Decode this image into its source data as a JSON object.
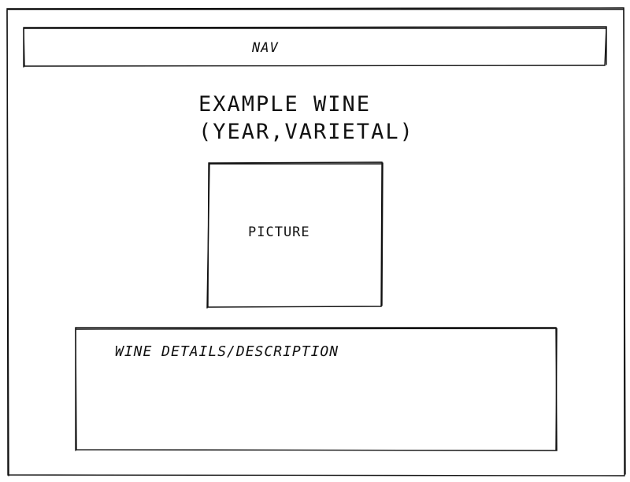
{
  "nav": {
    "label": "NAV"
  },
  "wine": {
    "title_line_1": "EXAMPLE WINE",
    "title_line_2": "(YEAR,VARIETAL)"
  },
  "picture": {
    "label": "PICTURE"
  },
  "details": {
    "label": "WINE DETAILS/DESCRIPTION"
  },
  "colors": {
    "stroke": "#111111",
    "background": "#ffffff"
  }
}
